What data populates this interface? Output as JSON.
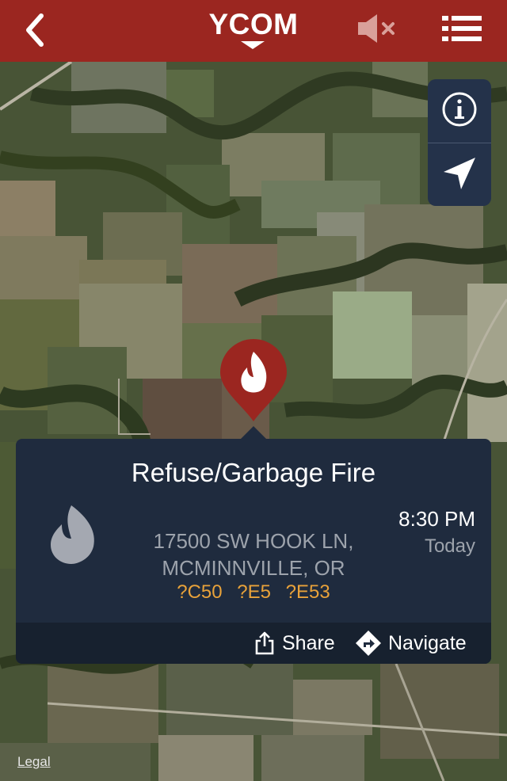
{
  "header": {
    "title": "YCOM",
    "accent_color": "#9b2620",
    "icons": [
      "back-arrow-icon",
      "chevron-down-icon",
      "mute-speaker-icon",
      "list-menu-icon"
    ]
  },
  "map_controls": {
    "icons": [
      "info-icon",
      "location-arrow-icon"
    ]
  },
  "incident": {
    "type": "Refuse/Garbage Fire",
    "address_line1": "17500 SW HOOK LN,",
    "address_line2": "MCMINNVILLE, OR",
    "units": [
      "?C50",
      "?E5",
      "?E53"
    ],
    "time": "8:30 PM",
    "day": "Today",
    "icon": "flame-icon",
    "pin_color": "#9b2620",
    "units_color": "#e8a23a"
  },
  "actions": {
    "share_label": "Share",
    "navigate_label": "Navigate"
  },
  "map": {
    "legal_label": "Legal"
  }
}
